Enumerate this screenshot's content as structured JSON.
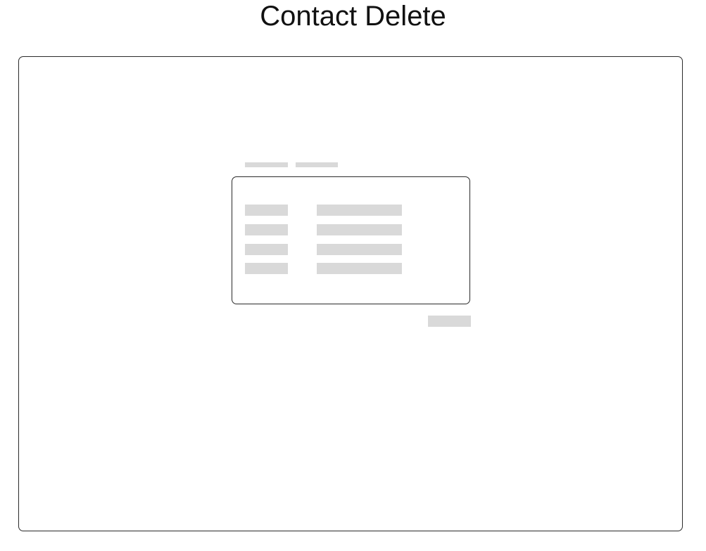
{
  "page": {
    "title": "Contact Delete"
  },
  "colors": {
    "placeholder_gray": "#d9d9d9",
    "border": "#2a2a2a",
    "background": "#ffffff"
  }
}
